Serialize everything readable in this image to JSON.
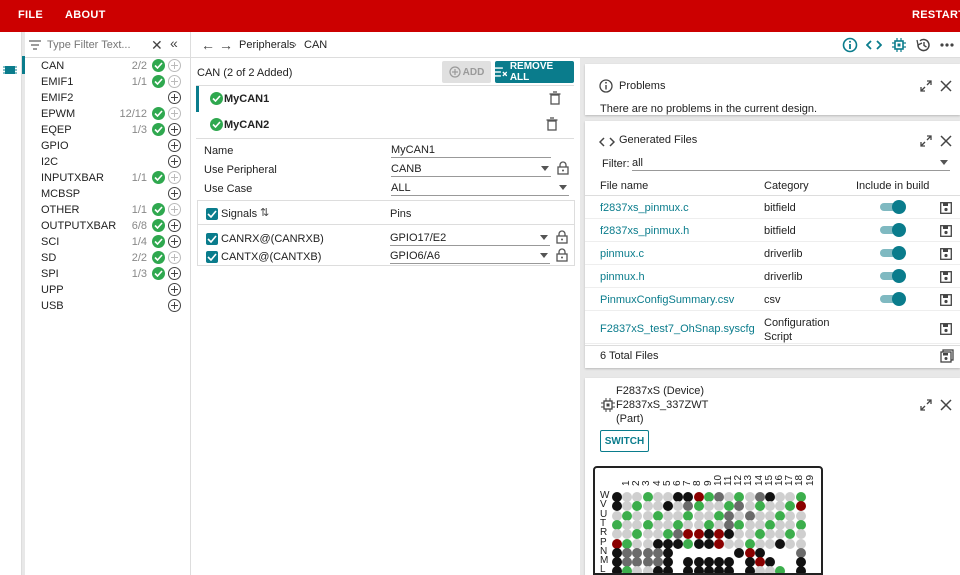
{
  "menu": {
    "file": "FILE",
    "about": "ABOUT",
    "restart": "RESTART"
  },
  "filter": {
    "placeholder": "Type Filter Text..."
  },
  "modules": [
    {
      "name": "CAN",
      "count": "2/2",
      "ok": true,
      "addable": false
    },
    {
      "name": "EMIF1",
      "count": "1/1",
      "ok": true,
      "addable": false
    },
    {
      "name": "EMIF2",
      "count": "",
      "ok": false,
      "addable": true
    },
    {
      "name": "EPWM",
      "count": "12/12",
      "ok": true,
      "addable": false
    },
    {
      "name": "EQEP",
      "count": "1/3",
      "ok": true,
      "addable": true
    },
    {
      "name": "GPIO",
      "count": "",
      "ok": false,
      "addable": true
    },
    {
      "name": "I2C",
      "count": "",
      "ok": false,
      "addable": true
    },
    {
      "name": "INPUTXBAR",
      "count": "1/1",
      "ok": true,
      "addable": false
    },
    {
      "name": "MCBSP",
      "count": "",
      "ok": false,
      "addable": true
    },
    {
      "name": "OTHER",
      "count": "1/1",
      "ok": true,
      "addable": false
    },
    {
      "name": "OUTPUTXBAR",
      "count": "6/8",
      "ok": true,
      "addable": true
    },
    {
      "name": "SCI",
      "count": "1/4",
      "ok": true,
      "addable": true
    },
    {
      "name": "SD",
      "count": "2/2",
      "ok": true,
      "addable": false
    },
    {
      "name": "SPI",
      "count": "1/3",
      "ok": true,
      "addable": true
    },
    {
      "name": "UPP",
      "count": "",
      "ok": false,
      "addable": true
    },
    {
      "name": "USB",
      "count": "",
      "ok": false,
      "addable": true
    }
  ],
  "breadcrumb": {
    "root": "Peripherals",
    "current": "CAN"
  },
  "panel": {
    "header": "CAN (2 of 2 Added)",
    "add_label": "ADD",
    "remove_all_label": "REMOVE ALL",
    "instances": [
      "MyCAN1",
      "MyCAN2"
    ],
    "fields": {
      "name_label": "Name",
      "name_value": "MyCAN1",
      "peripheral_label": "Use Peripheral",
      "peripheral_value": "CANB",
      "usecase_label": "Use Case",
      "usecase_value": "ALL"
    },
    "signals_label": "Signals",
    "pins_label": "Pins",
    "signals": [
      {
        "name": "CANRX@(CANRXB)",
        "pin": "GPIO17/E2"
      },
      {
        "name": "CANTX@(CANTXB)",
        "pin": "GPIO6/A6"
      }
    ]
  },
  "problems": {
    "title": "Problems",
    "message": "There are no problems in the current design."
  },
  "generated": {
    "title": "Generated Files",
    "filter_label": "Filter:",
    "filter_value": "all",
    "col_file": "File name",
    "col_category": "Category",
    "col_include": "Include in build",
    "files": [
      {
        "name": "f2837xs_pinmux.c",
        "category": "bitfield",
        "toggle": true
      },
      {
        "name": "f2837xs_pinmux.h",
        "category": "bitfield",
        "toggle": true
      },
      {
        "name": "pinmux.c",
        "category": "driverlib",
        "toggle": true
      },
      {
        "name": "pinmux.h",
        "category": "driverlib",
        "toggle": true
      },
      {
        "name": "PinmuxConfigSummary.csv",
        "category": "csv",
        "toggle": true
      },
      {
        "name": "F2837xS_test7_OhSnap.syscfg",
        "category": "Configuration",
        "category2": "Script",
        "toggle": false
      }
    ],
    "total": "6 Total Files"
  },
  "device": {
    "line1": "F2837xS (Device)",
    "line2": "F2837xS_337ZWT",
    "line3": "(Part)",
    "switch_label": "SWITCH",
    "columns": [
      "1",
      "2",
      "3",
      "4",
      "5",
      "6",
      "7",
      "8",
      "9",
      "10",
      "11",
      "12",
      "13",
      "14",
      "15",
      "16",
      "17",
      "18",
      "19"
    ],
    "rows": [
      "W",
      "V",
      "U",
      "T",
      "R",
      "P",
      "N",
      "M",
      "L"
    ],
    "grid": [
      "KGGGGGKKRGDGGGDKGGG",
      "KGGGGKGDGGGGDGGGGGR",
      "GGGGGGGGGGGDGDGGGGG",
      "GGGGGGGGGGGDGGGGGGG",
      "GGGGGGDRRKRKGGGGGGG",
      "RGGGKKKGKKRGGGGGKGG",
      "KDDDDK......KRK...D",
      "KDDDDK.KKKKK.KRK..K",
      "KGGGKK.KKKKK.KGGG.K"
    ],
    "colors": {
      "G": "#cfcfcf",
      "K": "#111111",
      "R": "#8b0000",
      "D": "#6b6b6b",
      "N": "#3cae4c"
    }
  },
  "colors": {
    "brand": "#cc0000",
    "accent": "#0a7c8c",
    "ok": "#2fa84f"
  }
}
